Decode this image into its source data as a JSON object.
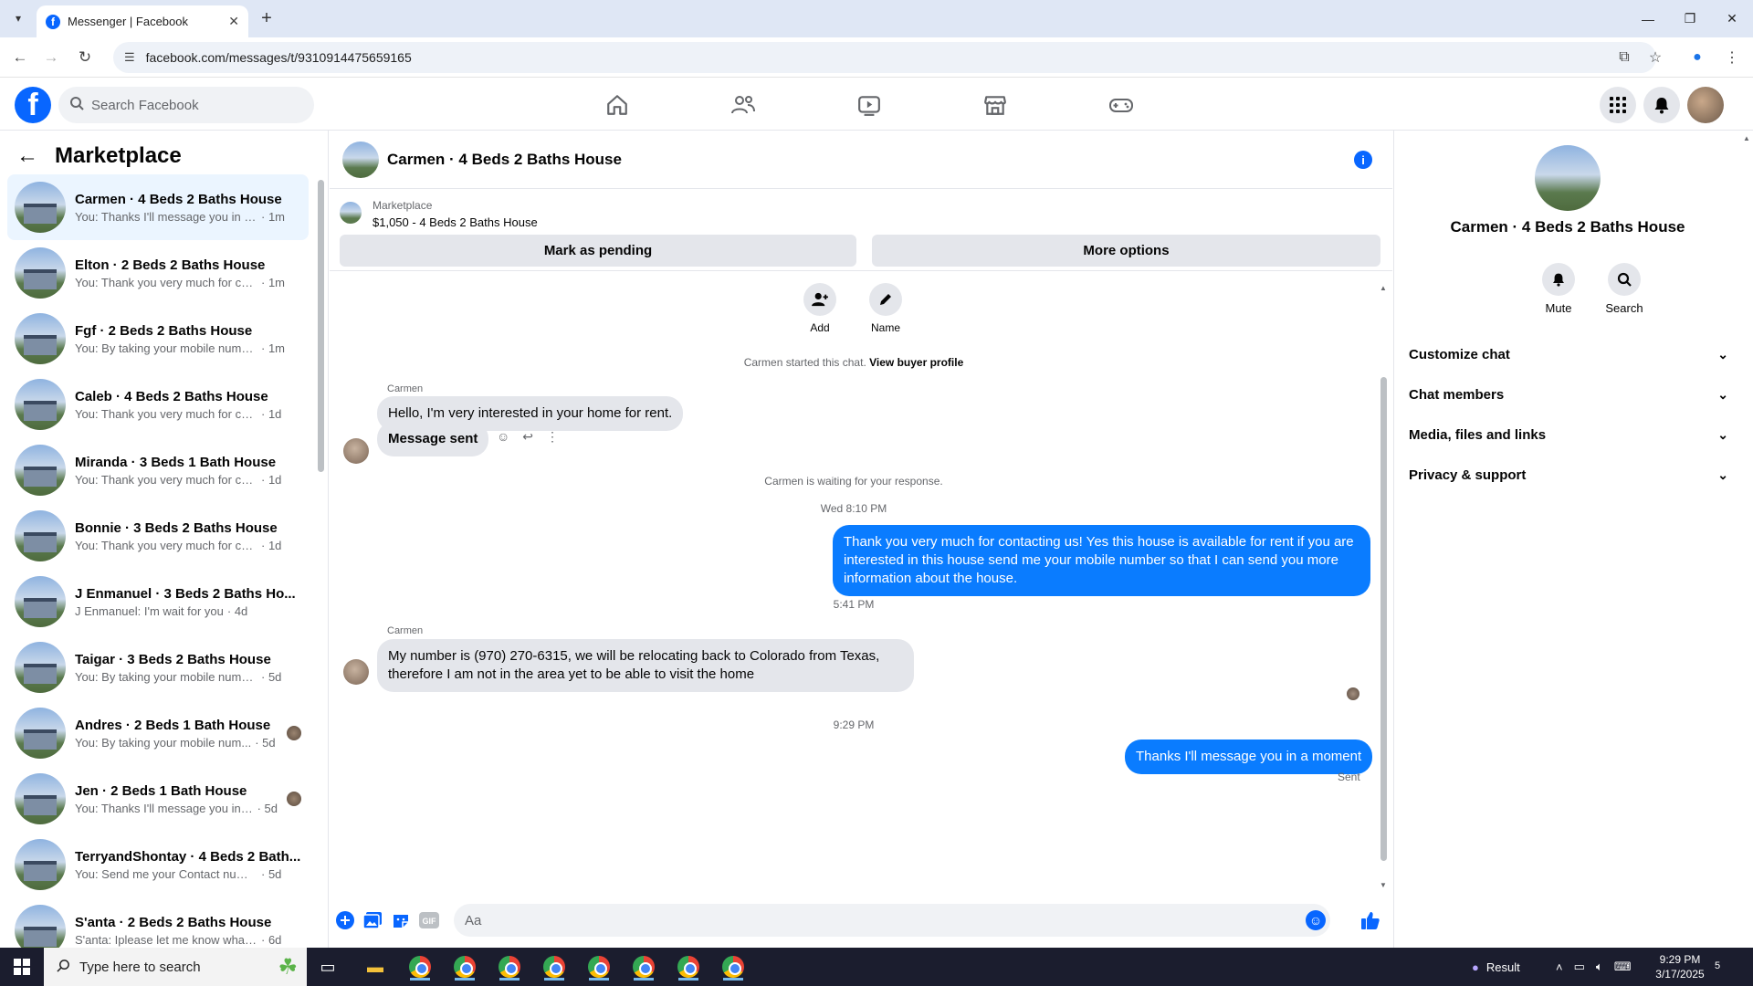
{
  "browser": {
    "tab_title": "Messenger | Facebook",
    "url": "facebook.com/messages/t/9310914475659165"
  },
  "fb": {
    "search_placeholder": "Search Facebook"
  },
  "sidebar": {
    "title": "Marketplace",
    "conversations": [
      {
        "name": "Carmen · 4 Beds 2 Baths House",
        "preview": "You: Thanks I'll message you in a ...",
        "time": "· 1m",
        "active": true
      },
      {
        "name": "Elton · 2 Beds 2 Baths House",
        "preview": "You: Thank you very much for cont...",
        "time": "· 1m"
      },
      {
        "name": "Fgf · 2 Beds 2 Baths House",
        "preview": "You: By taking your mobile numbe...",
        "time": "· 1m"
      },
      {
        "name": "Caleb · 4 Beds 2 Baths House",
        "preview": "You: Thank you very much for cont...",
        "time": "· 1d"
      },
      {
        "name": "Miranda · 3 Beds 1 Bath House",
        "preview": "You: Thank you very much for cont...",
        "time": "· 1d"
      },
      {
        "name": "Bonnie · 3 Beds 2 Baths House",
        "preview": "You: Thank you very much for cont...",
        "time": "· 1d"
      },
      {
        "name": "J Enmanuel · 3 Beds 2 Baths Ho...",
        "preview": "J Enmanuel: I'm wait for you",
        "time": "· 4d"
      },
      {
        "name": "Taigar · 3 Beds 2 Baths House",
        "preview": "You: By taking your mobile number...",
        "time": "· 5d"
      },
      {
        "name": "Andres · 2 Beds 1 Bath House",
        "preview": "You: By taking your mobile num...",
        "time": "· 5d"
      },
      {
        "name": "Jen · 2 Beds 1 Bath House",
        "preview": "You: Thanks I'll message you in ...",
        "time": "· 5d"
      },
      {
        "name": "TerryandShontay · 4 Beds 2 Bath...",
        "preview": "You: Send me your Contact number...",
        "time": "· 5d"
      },
      {
        "name": "S'anta · 2 Beds 2 Baths House",
        "preview": "S'anta: Iplease let me know what p...",
        "time": "· 6d"
      }
    ]
  },
  "chat": {
    "title": "Carmen · 4 Beds 2 Baths House",
    "marketplace_label": "Marketplace",
    "listing": "$1,050 - 4 Beds 2 Baths House",
    "mark_pending": "Mark as pending",
    "more_options": "More options",
    "add_label": "Add",
    "name_label": "Name",
    "started_text": "Carmen started this chat.",
    "view_buyer": "View buyer profile",
    "sender1": "Carmen",
    "msg1": "Hello, I'm very interested in your home for rent.",
    "msg2": "Message sent",
    "waiting": "Carmen is waiting for your response.",
    "time1": "Wed 8:10 PM",
    "out1": "Thank you very much for contacting us! Yes this house is available for rent if you are interested in this house send me your mobile number so that I can send you more information about the house.",
    "time2": "5:41 PM",
    "sender2": "Carmen",
    "msg3": "My number is (970) 270-6315, we will be relocating back to Colorado from Texas, therefore I am not in the area yet to be able to visit the home",
    "time3": "9:29 PM",
    "out2": "Thanks I'll message you in a moment",
    "sent_status": "Sent",
    "composer_placeholder": "Aa"
  },
  "rpanel": {
    "name": "Carmen · 4 Beds 2 Baths House",
    "mute": "Mute",
    "search": "Search",
    "sections": [
      "Customize chat",
      "Chat members",
      "Media, files and links",
      "Privacy & support"
    ]
  },
  "taskbar": {
    "search_placeholder": "Type here to search",
    "result": "Result",
    "time": "9:29 PM",
    "date": "3/17/2025",
    "notif_count": "5"
  },
  "colors": {
    "brand": "#0866ff",
    "outgoing_bubble": "#0a7cff",
    "incoming_bubble": "#e4e6eb"
  }
}
